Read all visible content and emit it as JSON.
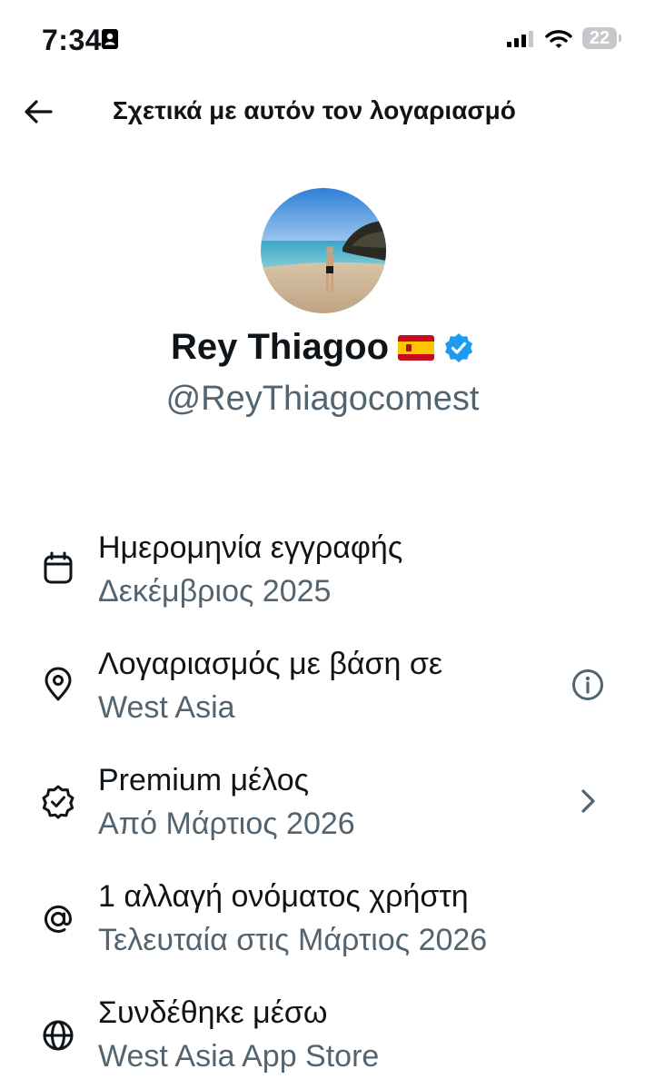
{
  "status_bar": {
    "time": "7:34",
    "battery": "22",
    "icons": [
      "contact-card-icon",
      "cellular-signal-icon",
      "wifi-icon",
      "battery-icon"
    ]
  },
  "header": {
    "title": "Σχετικά με αυτόν τον λογαριασμό",
    "back_icon": "arrow-left-icon"
  },
  "profile": {
    "display_name": "Rey Thiagoo",
    "flag": "🇪🇸",
    "verified": true,
    "handle": "@ReyThiagocomest"
  },
  "rows": [
    {
      "icon": "calendar-icon",
      "label": "Ημερομηνία εγγραφής",
      "value": "Δεκέμβριος 2025",
      "action": null
    },
    {
      "icon": "location-pin-icon",
      "label": "Λογαριασμός με βάση σε",
      "value": "West Asia",
      "action": "info-icon"
    },
    {
      "icon": "verified-badge-icon",
      "label": "Premium μέλος",
      "value": "Από Μάρτιος 2026",
      "action": "chevron-right-icon"
    },
    {
      "icon": "at-sign-icon",
      "label": "1 αλλαγή ονόματος χρήστη",
      "value": "Τελευταία στις Μάρτιος 2026",
      "action": null
    },
    {
      "icon": "globe-icon",
      "label": "Συνδέθηκε μέσω",
      "value": "West Asia App Store",
      "action": null
    }
  ],
  "colors": {
    "text_primary": "#0f1419",
    "text_secondary": "#536471",
    "verified_blue": "#1d9bf0"
  }
}
